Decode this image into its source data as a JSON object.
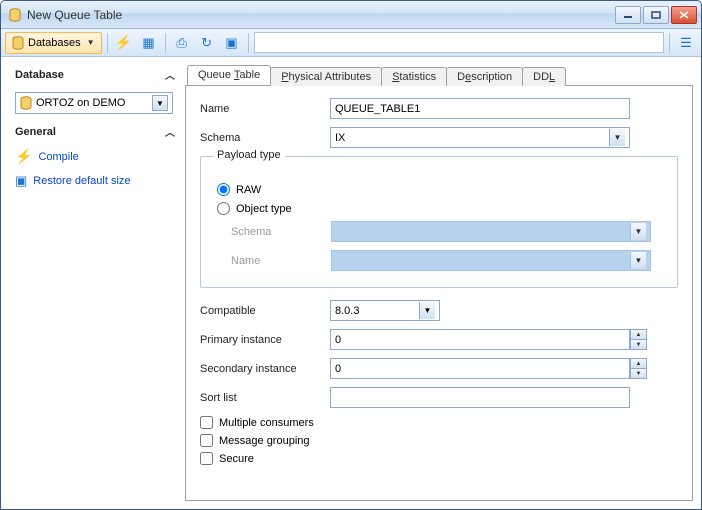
{
  "window": {
    "title": "New Queue Table"
  },
  "toolbar": {
    "databases_label": "Databases",
    "combo_value": ""
  },
  "sidebar": {
    "database_header": "Database",
    "db_value": "ORTOZ on DEMO",
    "general_header": "General",
    "compile_label": "Compile",
    "restore_label": "Restore default size"
  },
  "tabs": [
    {
      "label_pre": "Queue ",
      "label_ul": "T",
      "label_post": "able"
    },
    {
      "label_pre": "",
      "label_ul": "P",
      "label_post": "hysical Attributes"
    },
    {
      "label_pre": "",
      "label_ul": "S",
      "label_post": "tatistics"
    },
    {
      "label_pre": "D",
      "label_ul": "e",
      "label_post": "scription"
    },
    {
      "label_pre": "DD",
      "label_ul": "L",
      "label_post": ""
    }
  ],
  "form": {
    "name_label": "Name",
    "name_value": "QUEUE_TABLE1",
    "schema_label": "Schema",
    "schema_value": "IX",
    "payload_legend": "Payload type",
    "raw_label": "RAW",
    "object_type_label": "Object type",
    "obj_schema_label": "Schema",
    "obj_schema_value": "",
    "obj_name_label": "Name",
    "obj_name_value": "",
    "compatible_label": "Compatible",
    "compatible_value": "8.0.3",
    "primary_label": "Primary instance",
    "primary_value": "0",
    "secondary_label": "Secondary instance",
    "secondary_value": "0",
    "sortlist_label": "Sort list",
    "sortlist_value": "",
    "multiple_label": "Multiple consumers",
    "grouping_label": "Message grouping",
    "secure_label": "Secure"
  }
}
